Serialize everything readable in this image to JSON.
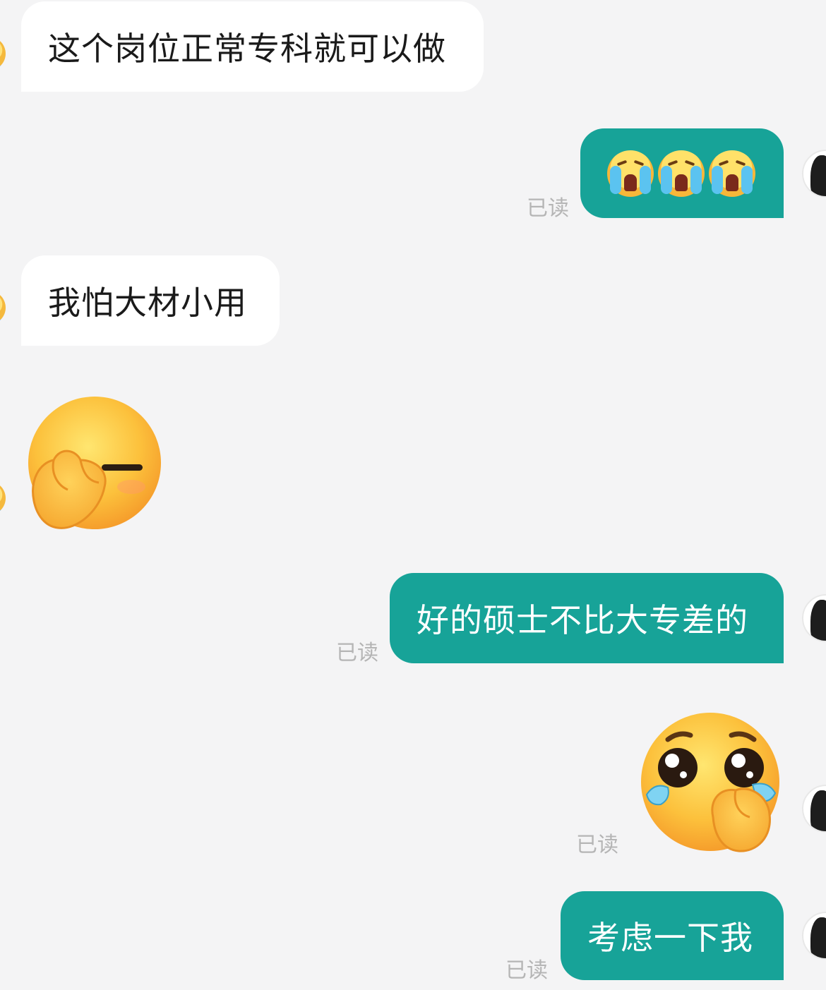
{
  "messages": [
    {
      "side": "in",
      "type": "text",
      "text": "这个岗位正常专科就可以做"
    },
    {
      "side": "out",
      "type": "emoji",
      "emoji": "loudly-crying-face x3",
      "read_status": "已读"
    },
    {
      "side": "in",
      "type": "text",
      "text": "我怕大材小用"
    },
    {
      "side": "in",
      "type": "sticker",
      "emoji": "facepalm-face"
    },
    {
      "side": "out",
      "type": "text",
      "text": "好的硕士不比大专差的",
      "read_status": "已读"
    },
    {
      "side": "out",
      "type": "sticker",
      "emoji": "pleading-face-holding-back-tears",
      "read_status": "已读"
    },
    {
      "side": "out",
      "type": "text",
      "text": "考虑一下我",
      "read_status": "已读"
    }
  ],
  "colors": {
    "background": "#f4f4f5",
    "incoming_bubble": "#ffffff",
    "outgoing_bubble": "#17a398",
    "read_label": "#b5b5b5"
  }
}
